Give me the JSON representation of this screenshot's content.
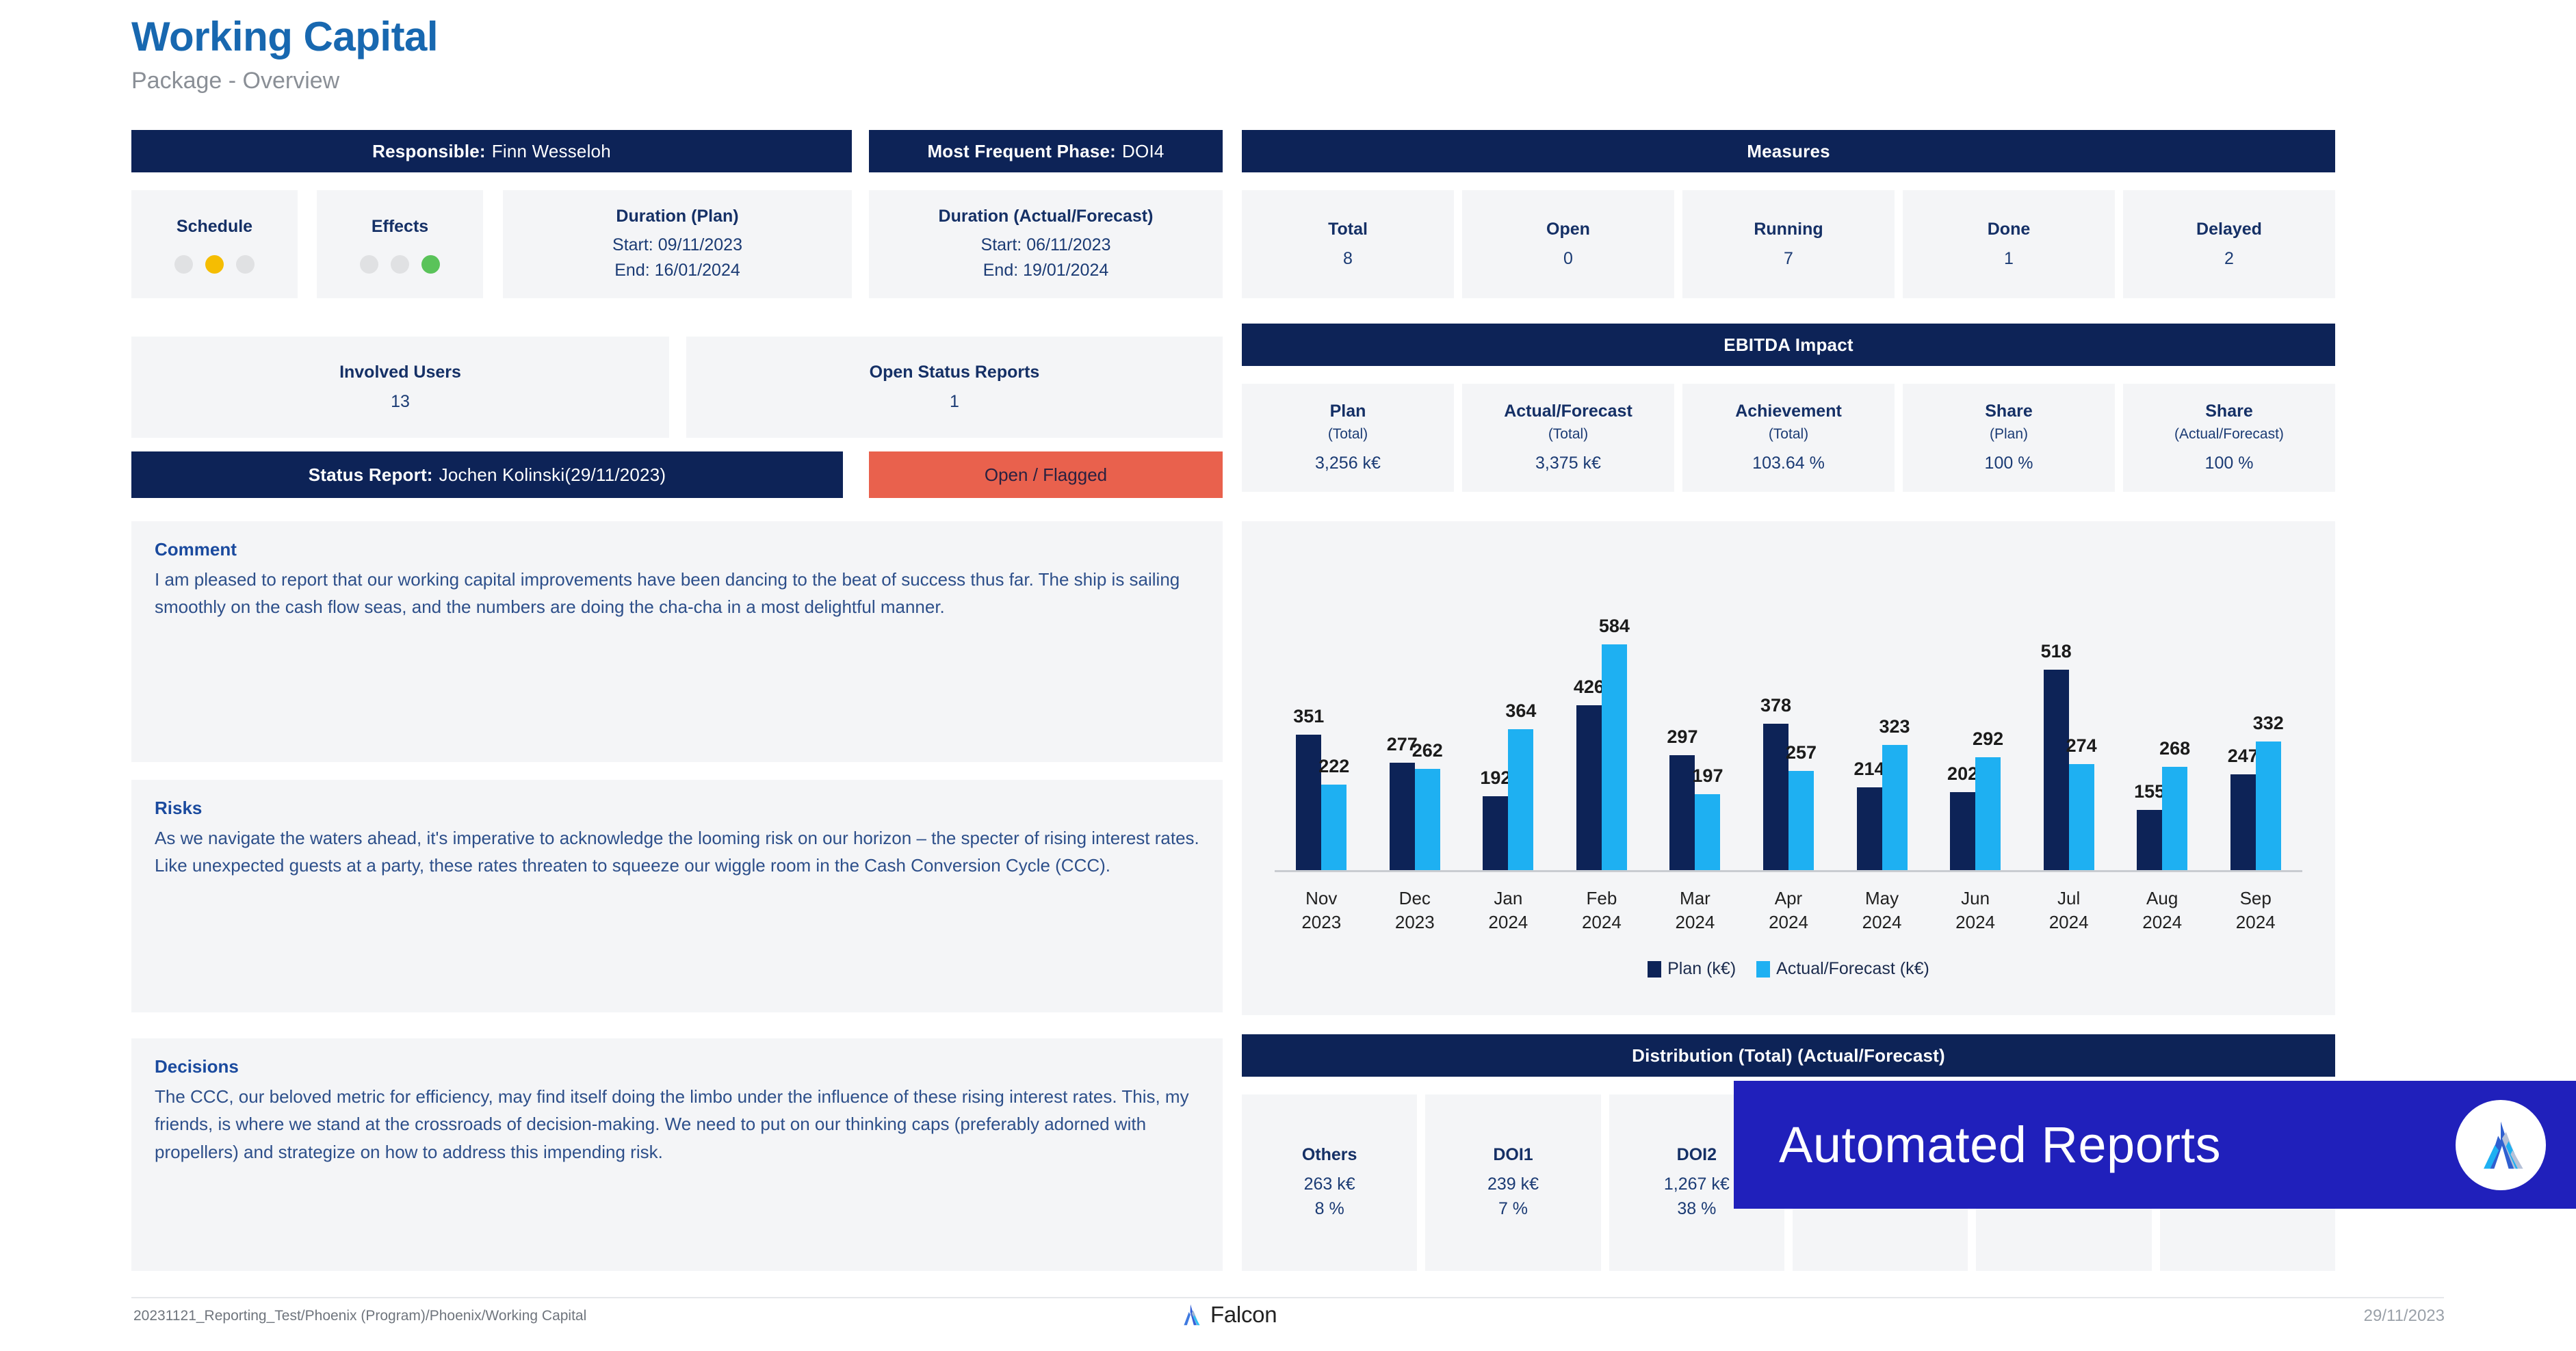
{
  "header": {
    "title": "Working Capital",
    "subtitle": "Package - Overview"
  },
  "responsible": {
    "label": "Responsible:",
    "value": "Finn Wesseloh"
  },
  "most_frequent_phase": {
    "label": "Most Frequent Phase:",
    "value": "DOI4"
  },
  "status_tiles": {
    "schedule": {
      "label": "Schedule",
      "lights": [
        "grey",
        "amber",
        "grey"
      ]
    },
    "effects": {
      "label": "Effects",
      "lights": [
        "grey",
        "grey",
        "green"
      ]
    },
    "duration_plan": {
      "label": "Duration (Plan)",
      "start": "Start: 09/11/2023",
      "end": "End: 16/01/2024"
    },
    "duration_actual": {
      "label": "Duration (Actual/Forecast)",
      "start": "Start: 06/11/2023",
      "end": "End: 19/01/2024"
    }
  },
  "involved_users": {
    "label": "Involved Users",
    "value": "13"
  },
  "open_status_reports": {
    "label": "Open Status Reports",
    "value": "1"
  },
  "status_report": {
    "label": "Status Report:",
    "value": "Jochen Kolinski(29/11/2023)",
    "badge": "Open / Flagged",
    "badge_color": "#e9614d"
  },
  "measures": {
    "title": "Measures",
    "items": [
      {
        "label": "Total",
        "value": "8"
      },
      {
        "label": "Open",
        "value": "0"
      },
      {
        "label": "Running",
        "value": "7"
      },
      {
        "label": "Done",
        "value": "1"
      },
      {
        "label": "Delayed",
        "value": "2"
      }
    ]
  },
  "ebitda": {
    "title": "EBITDA Impact",
    "items": [
      {
        "label": "Plan",
        "sub": "(Total)",
        "value": "3,256 k€"
      },
      {
        "label": "Actual/Forecast",
        "sub": "(Total)",
        "value": "3,375 k€"
      },
      {
        "label": "Achievement",
        "sub": "(Total)",
        "value": "103.64 %"
      },
      {
        "label": "Share",
        "sub": "(Plan)",
        "value": "100 %"
      },
      {
        "label": "Share",
        "sub": "(Actual/Forecast)",
        "value": "100 %"
      }
    ]
  },
  "comment": {
    "heading": "Comment",
    "body": "I am pleased to report that our working capital improvements have been dancing to the beat of success thus far. The ship is sailing smoothly on the cash flow seas, and the numbers are doing the cha-cha in a most delightful manner."
  },
  "risks": {
    "heading": "Risks",
    "body": "As we navigate the waters ahead, it's imperative to acknowledge the looming risk on our horizon – the specter of rising interest rates. Like unexpected guests at a party, these rates threaten to squeeze our wiggle room in the Cash Conversion Cycle (CCC)."
  },
  "decisions": {
    "heading": "Decisions",
    "body": "The CCC, our beloved metric for efficiency, may find itself doing the limbo under the influence of these rising interest rates. This, my friends, is where we stand at the crossroads of decision-making. We need to put on our thinking caps (preferably adorned with propellers) and strategize on how to address this impending risk."
  },
  "distribution": {
    "title": "Distribution (Total) (Actual/Forecast)",
    "items": [
      {
        "label": "Others",
        "value": "263 k€",
        "share": "8 %"
      },
      {
        "label": "DOI1",
        "value": "239 k€",
        "share": "7 %"
      },
      {
        "label": "DOI2",
        "value": "1,267 k€",
        "share": "38 %"
      },
      {
        "label": "",
        "value": "",
        "share": ""
      },
      {
        "label": "",
        "value": "",
        "share": ""
      },
      {
        "label": "",
        "value": "",
        "share": ""
      }
    ]
  },
  "banner": {
    "text": "Automated Reports",
    "color": "#2020bb"
  },
  "footer": {
    "path": "20231121_Reporting_Test/Phoenix (Program)/Phoenix/Working Capital",
    "brand": "Falcon",
    "date": "29/11/2023"
  },
  "chart_data": {
    "type": "bar",
    "title": "",
    "xlabel": "",
    "ylabel": "",
    "ylim": [
      0,
      640
    ],
    "grid": false,
    "legend_position": "bottom",
    "categories": [
      "Nov 2023",
      "Dec 2023",
      "Jan 2024",
      "Feb 2024",
      "Mar 2024",
      "Apr 2024",
      "May 2024",
      "Jun 2024",
      "Jul 2024",
      "Aug 2024",
      "Sep 2024"
    ],
    "tick_lines": [
      [
        "Nov",
        "2023"
      ],
      [
        "Dec",
        "2023"
      ],
      [
        "Jan",
        "2024"
      ],
      [
        "Feb",
        "2024"
      ],
      [
        "Mar",
        "2024"
      ],
      [
        "Apr",
        "2024"
      ],
      [
        "May",
        "2024"
      ],
      [
        "Jun",
        "2024"
      ],
      [
        "Jul",
        "2024"
      ],
      [
        "Aug",
        "2024"
      ],
      [
        "Sep",
        "2024"
      ]
    ],
    "series": [
      {
        "name": "Plan (k€)",
        "color": "#0d2357",
        "values": [
          351,
          277,
          192,
          426,
          297,
          378,
          214,
          202,
          518,
          155,
          247
        ]
      },
      {
        "name": "Actual/Forecast (k€)",
        "color": "#1eb0f2",
        "values": [
          222,
          262,
          364,
          584,
          197,
          257,
          323,
          292,
          274,
          268,
          332
        ]
      }
    ]
  }
}
